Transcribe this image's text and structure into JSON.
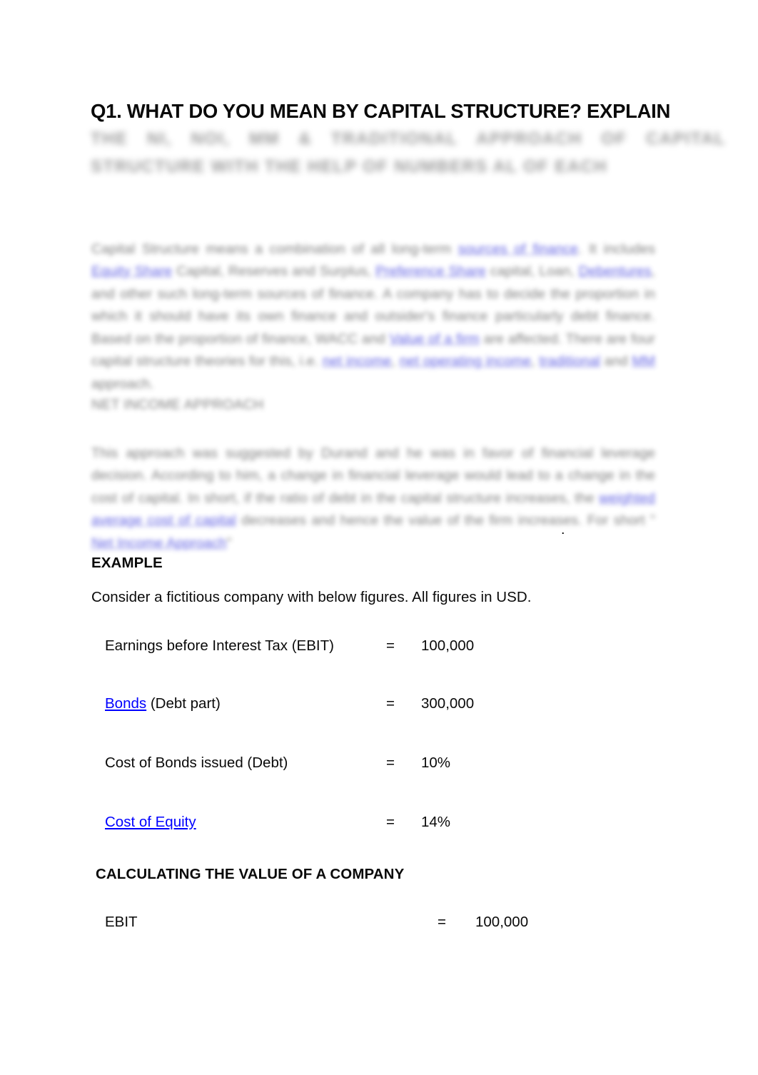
{
  "document": {
    "title": "Q1. WHAT DO YOU MEAN BY CAPITAL STRUCTURE? EXPLAIN",
    "title_continuation": "THE NI, NOI, MM & TRADITIONAL APPROACH OF CAPITAL STRUCTURE WITH THE HELP OF NUMBERS AL OF EACH",
    "intro_paragraph": "Capital Structure means a combination of all long-term sources of finance. It includes Equity Share Capital, Reserves and Surplus, Preference Share capital, Loan, Debentures, and other such long-term sources of finance. A company has to decide the proportion in which it should have its own finance and outsider's finance particularly debt finance. Based on the proportion of finance, WACC and Value of a firm are affected. There are four capital structure theories for this, i.e. net income, net operating income, traditional and MM approach.",
    "intro_links": [
      "sources of finance",
      "Equity Share",
      "Preference Share",
      "Debentures",
      "Value of a firm",
      "net income",
      "net operating income",
      "traditional",
      "MM"
    ],
    "ni_heading": "NET INCOME APPROACH",
    "ni_paragraph": "This approach was suggested by Durand and he was in favor of financial leverage decision. According to him, a change in financial leverage would lead to a change in the cost of capital. In short, if the ratio of debt in the capital structure increases, the weighted average cost of capital decreases and hence the value of the firm increases. For short \" Net Income Approach\"",
    "ni_links": [
      "weighted average cost of capital",
      "Net Income Approach"
    ],
    "ni_trailing_punctuation": ".",
    "example_heading": "EXAMPLE",
    "example_intro": "Consider a fictitious company with below figures. All figures in USD.",
    "figures": [
      {
        "label": "Earnings before Interest Tax (EBIT)",
        "label_link": "",
        "label_rest": "Earnings before Interest Tax (EBIT)",
        "equals": "=",
        "value": "100,000"
      },
      {
        "label": "Bonds (Debt part)",
        "label_link": "Bonds",
        "label_rest": " (Debt part)",
        "equals": "=",
        "value": "300,000"
      },
      {
        "label": "Cost of Bonds issued (Debt)",
        "label_link": "",
        "label_rest": "Cost of Bonds issued (Debt)",
        "equals": "=",
        "value": "10%"
      },
      {
        "label": "Cost of Equity",
        "label_link": "Cost of Equity",
        "label_rest": "",
        "equals": "=",
        "value": "14%"
      }
    ],
    "calc_heading": "CALCULATING THE VALUE OF A COMPANY",
    "calc_rows": [
      {
        "label": "EBIT",
        "equals": "=",
        "value": "100,000"
      }
    ],
    "colors": {
      "link": "#0000FF",
      "text": "#0A0A0A",
      "background": "#FFFFFF",
      "highlight": "#EFEFEF"
    }
  }
}
